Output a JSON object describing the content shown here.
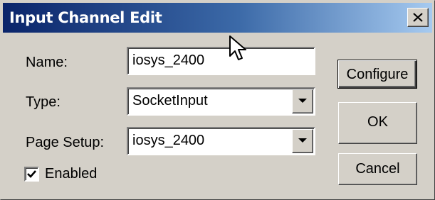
{
  "window": {
    "title": "Input Channel Edit",
    "close_label": "X"
  },
  "form": {
    "name_label": "Name:",
    "name_value": "iosys_2400",
    "type_label": "Type:",
    "type_value": "SocketInput",
    "page_setup_label": "Page Setup:",
    "page_setup_value": "iosys_2400",
    "enabled_label": "Enabled",
    "enabled_checked": true
  },
  "buttons": {
    "configure": "Configure",
    "ok": "OK",
    "cancel": "Cancel"
  },
  "icons": {
    "close": "close-icon",
    "dropdown": "chevron-down-icon",
    "check": "checkmark-icon",
    "cursor": "mouse-pointer-icon"
  },
  "colors": {
    "title_start": "#0a246a",
    "title_end": "#a6caf0",
    "dialog_face": "#d4d0c8"
  }
}
